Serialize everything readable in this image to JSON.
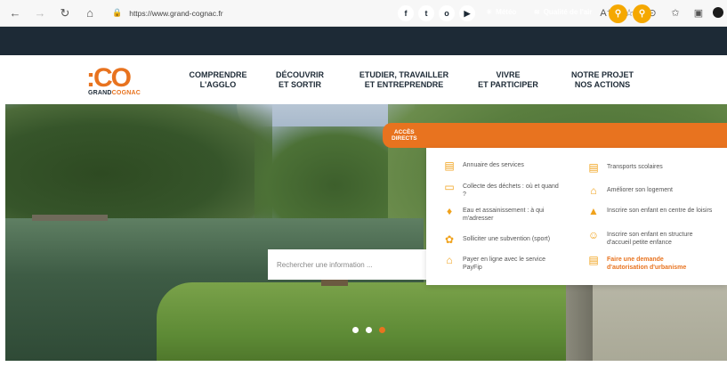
{
  "browser": {
    "url": "https://www.grand-cognac.fr",
    "icons": [
      "back-icon",
      "forward-icon",
      "reload-icon",
      "home-icon",
      "lock-icon",
      "read-aloud-icon",
      "favorite-icon",
      "collections-icon",
      "favorites-bar-icon",
      "extensions-icon",
      "profile-icon"
    ]
  },
  "topbar": {
    "social": [
      "f",
      "t",
      "o",
      "▶"
    ],
    "meteo_label": "Météo",
    "air_label": "Qualité de l'air",
    "colors": {
      "bg": "#1d2a36",
      "accent": "#f5a800"
    }
  },
  "logo": {
    "mark": ":CO",
    "text_a": "GRAND",
    "text_b": "COGNAC"
  },
  "menu": [
    {
      "line1": "COMPRENDRE",
      "line2": "L'AGGLO"
    },
    {
      "line1": "DÉCOUVRIR",
      "line2": "ET SORTIR"
    },
    {
      "line1": "ETUDIER, TRAVAILLER",
      "line2": "ET ENTREPRENDRE"
    },
    {
      "line1": "VIVRE",
      "line2": "ET PARTICIPER"
    },
    {
      "line1": "NOTRE PROJET",
      "line2": "NOS ACTIONS"
    }
  ],
  "quick_access": {
    "tab_line1": "ACCÈS",
    "tab_line2": "DIRECTS",
    "items_left": [
      {
        "label": "Annuaire des services",
        "icon": "directory-icon"
      },
      {
        "label": "Collecte des déchets : où et quand ?",
        "icon": "trash-icon"
      },
      {
        "label": "Eau et assainissement : à qui m'adresser",
        "icon": "water-tap-icon"
      },
      {
        "label": "Solliciter une subvention (sport)",
        "icon": "subsidy-icon"
      },
      {
        "label": "Payer en ligne avec le service PayFip",
        "icon": "home-pay-icon"
      }
    ],
    "items_right": [
      {
        "label": "Transports scolaires",
        "icon": "bus-icon"
      },
      {
        "label": "Améliorer son logement",
        "icon": "house-icon"
      },
      {
        "label": "Inscrire son enfant en centre de loisirs",
        "icon": "tent-icon"
      },
      {
        "label": "Inscrire son enfant en structure d'accueil petite enfance",
        "icon": "baby-icon"
      },
      {
        "label": "Faire une demande d'autorisation d'urbanisme",
        "icon": "permit-icon"
      }
    ],
    "accent": "#e8731f"
  },
  "search": {
    "placeholder": "Rechercher une information ..."
  },
  "carousel": {
    "slide_count": 3,
    "active": 3
  }
}
